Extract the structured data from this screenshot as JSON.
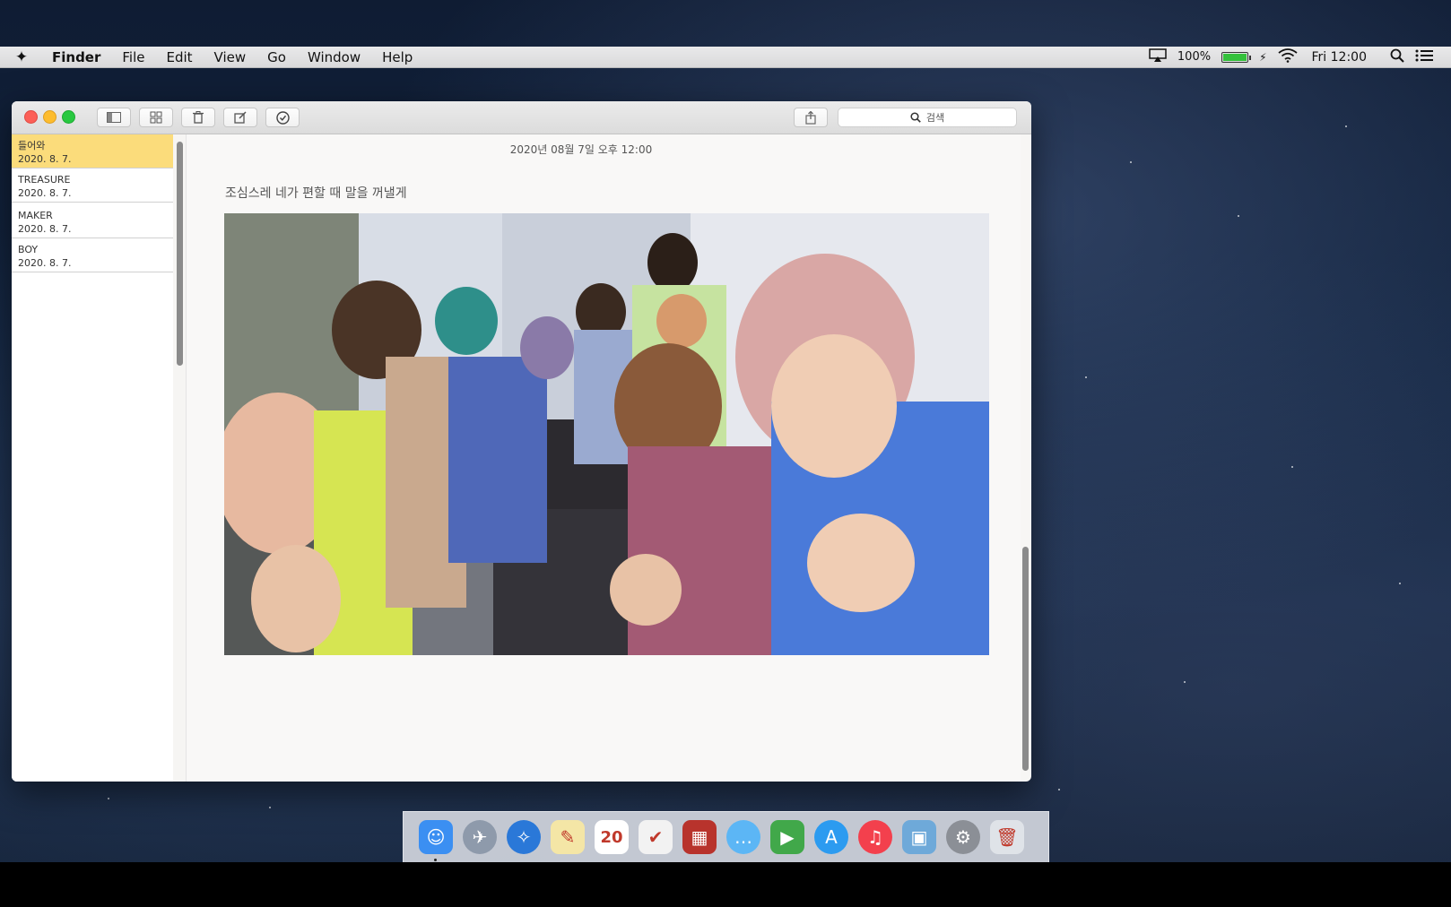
{
  "menubar": {
    "apple_glyph": "✦",
    "app_name": "Finder",
    "menus": [
      "File",
      "Edit",
      "View",
      "Go",
      "Window",
      "Help"
    ],
    "battery_percent": "100%",
    "battery_level": 1.0,
    "clock": "Fri 12:00"
  },
  "toolbar": {
    "search_placeholder": "검색"
  },
  "notes_list": [
    {
      "title": "들어와",
      "date": "2020. 8. 7.",
      "selected": true
    },
    {
      "title": "TREASURE",
      "date": "2020. 8. 7.",
      "selected": false
    },
    {
      "title": "MAKER",
      "date": "2020. 8. 7.",
      "selected": false
    },
    {
      "title": "BOY",
      "date": "2020. 8. 7.",
      "selected": false
    }
  ],
  "note": {
    "timestamp": "2020년 08월 7일 오후 12:00",
    "body": "조심스레 네가 편할 때 말을 꺼낼게"
  },
  "dock": {
    "items": [
      {
        "name": "finder-icon",
        "glyph": "☺",
        "color": "#3b8ff2",
        "running": true
      },
      {
        "name": "launchpad-icon",
        "glyph": "✈",
        "color": "#8e9aab",
        "running": false
      },
      {
        "name": "safari-icon",
        "glyph": "✧",
        "color": "#2a78d8",
        "running": false
      },
      {
        "name": "notes-icon",
        "glyph": "✎",
        "color": "#f4e6a6",
        "running": false
      },
      {
        "name": "calendar-icon",
        "glyph": "20",
        "color": "#ffffff",
        "running": false
      },
      {
        "name": "reminders-icon",
        "glyph": "✔",
        "color": "#f2f2f2",
        "running": false
      },
      {
        "name": "photo-booth-icon",
        "glyph": "▦",
        "color": "#b8332c",
        "running": false
      },
      {
        "name": "messages-icon",
        "glyph": "…",
        "color": "#5cb6f5",
        "running": false
      },
      {
        "name": "facetime-icon",
        "glyph": "▶",
        "color": "#41a84a",
        "running": false
      },
      {
        "name": "app-store-icon",
        "glyph": "A",
        "color": "#2c9bf0",
        "running": false
      },
      {
        "name": "music-icon",
        "glyph": "♫",
        "color": "#f3404d",
        "running": false
      },
      {
        "name": "preview-icon",
        "glyph": "▣",
        "color": "#6ea9d9",
        "running": false
      },
      {
        "name": "system-preferences-icon",
        "glyph": "⚙",
        "color": "#8b8f96",
        "running": false
      },
      {
        "name": "trash-icon",
        "glyph": "🗑",
        "color": "#dfe3e8",
        "running": false
      }
    ]
  }
}
